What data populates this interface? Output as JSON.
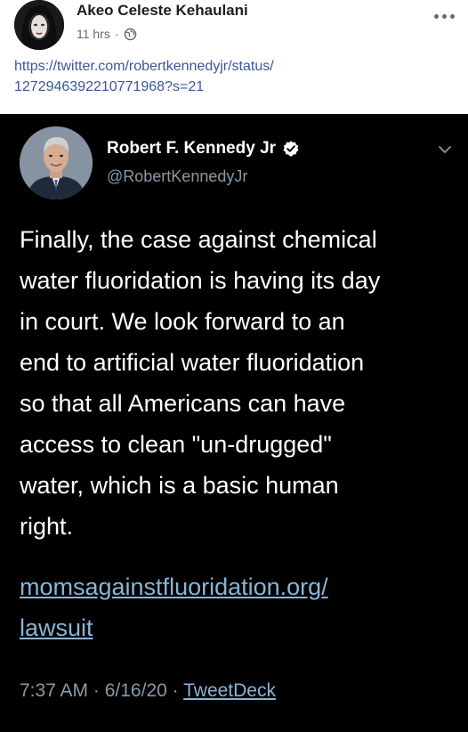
{
  "post": {
    "author_name": "Akeo Celeste Kehaulani",
    "time": "11 hrs",
    "separator": "·",
    "link_lines": [
      "https://twitter.com/robertkennedyjr/status/",
      "1272946392210771968?s=21"
    ]
  },
  "tweet": {
    "author_name": "Robert F. Kennedy Jr",
    "handle": "@RobertKennedyJr",
    "body_lines": [
      "Finally, the case against chemical",
      "water fluoridation is having its day",
      "in court. We look forward to an",
      "end to artificial water fluoridation",
      "so that all Americans can have",
      "access to clean \"un-drugged\"",
      "water, which is a basic human",
      "right."
    ],
    "link_lines": [
      "momsagainstfluoridation.org/",
      "lawsuit"
    ],
    "time": "7:37 AM",
    "date": "6/16/20",
    "sep1": " · ",
    "sep2": " · ",
    "source": "TweetDeck"
  },
  "colors": {
    "fb_link": "#385898",
    "tweet_bg": "#000000",
    "tweet_link": "#8ab4d6",
    "tweet_muted": "#8899a6",
    "verified": "#ffffff"
  },
  "icons": {
    "fb_privacy": "globe-icon",
    "fb_menu": "more-options-icon",
    "tweet_badge": "verified-badge-icon",
    "tweet_menu": "chevron-down-icon"
  }
}
